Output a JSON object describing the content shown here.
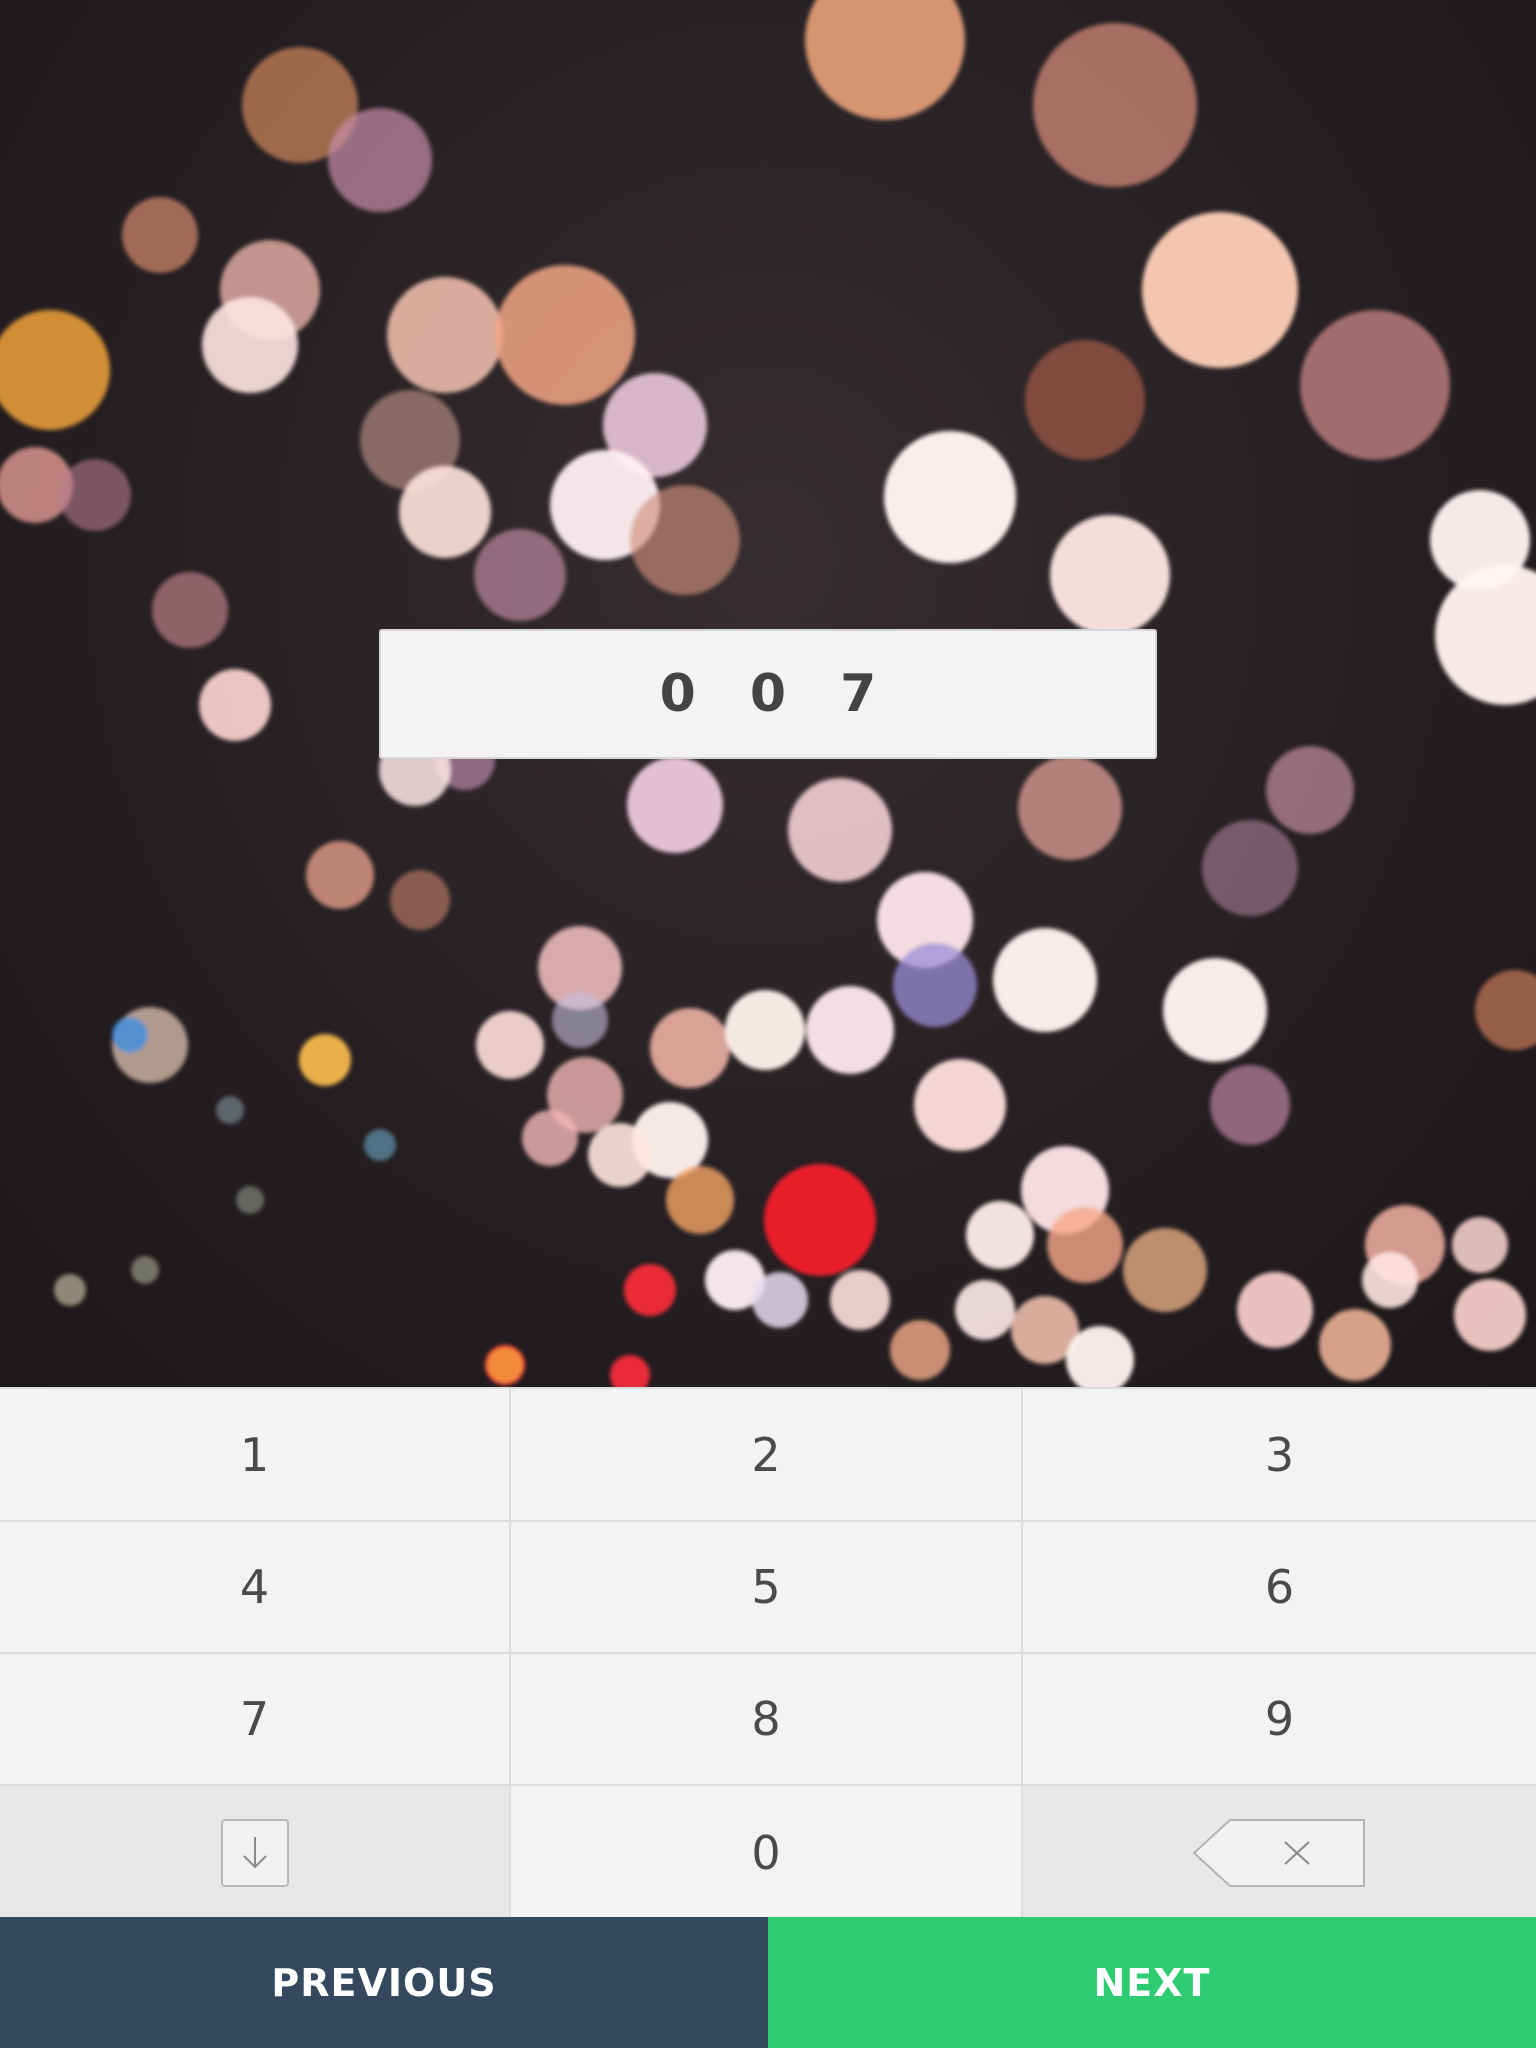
{
  "code_input": {
    "value": "0 0 7"
  },
  "keypad": {
    "keys": [
      "1",
      "2",
      "3",
      "4",
      "5",
      "6",
      "7",
      "8",
      "9",
      "0"
    ],
    "hide_keyboard_icon": "arrow-down-icon",
    "backspace_icon": "backspace-icon"
  },
  "nav": {
    "previous_label": "PREVIOUS",
    "next_label": "NEXT"
  },
  "colors": {
    "previous_bg": "#34495e",
    "next_bg": "#2ecc71"
  }
}
